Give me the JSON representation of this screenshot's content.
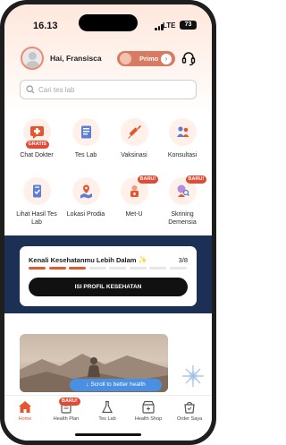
{
  "status_bar": {
    "time": "16.13",
    "network": "LTE",
    "battery": "73"
  },
  "header": {
    "greeting": "Hai, Fransisca",
    "membership_label": "Primo",
    "membership_arrow": "›",
    "support_icon": "headset-icon"
  },
  "search": {
    "placeholder": "Cari tes lab",
    "value": ""
  },
  "menu": [
    {
      "label": "Chat Dokter",
      "icon": "chat-doctor-icon",
      "badge": "GRATIS"
    },
    {
      "label": "Tes Lab",
      "icon": "lab-test-icon",
      "badge": ""
    },
    {
      "label": "Vaksinasi",
      "icon": "vaccine-icon",
      "badge": ""
    },
    {
      "label": "Konsultasi",
      "icon": "consultation-icon",
      "badge": ""
    },
    {
      "label": "Lihat Hasil Tes Lab",
      "icon": "lab-result-icon",
      "badge": ""
    },
    {
      "label": "Lokasi Prodia",
      "icon": "location-icon",
      "badge": ""
    },
    {
      "label": "Met-U",
      "icon": "met-u-icon",
      "badge": "BARU!"
    },
    {
      "label": "Skrining Demensia",
      "icon": "dementia-screening-icon",
      "badge": "BARU!"
    }
  ],
  "health_profile": {
    "title": "Kenali Kesehatanmu Lebih Dalam",
    "progress_text": "3/8",
    "progress_done": 3,
    "progress_total": 8,
    "button_label": "ISI PROFIL KESEHATAN"
  },
  "promo": {
    "scroll_hint": "Scroll to better health"
  },
  "bottom_nav": [
    {
      "label": "Home",
      "icon": "home-icon",
      "active": true,
      "badge": ""
    },
    {
      "label": "Health Plan",
      "icon": "health-plan-icon",
      "active": false,
      "badge": "BARU!"
    },
    {
      "label": "Tes Lab",
      "icon": "flask-icon",
      "active": false,
      "badge": ""
    },
    {
      "label": "Health Shop",
      "icon": "shop-icon",
      "active": false,
      "badge": ""
    },
    {
      "label": "Order Saya",
      "icon": "order-bag-icon",
      "active": false,
      "badge": ""
    }
  ],
  "colors": {
    "accent": "#e4572e",
    "primo": "#d77b63",
    "band": "#1c3055",
    "progress_active": "#e4572e",
    "toast": "#4a90e2"
  }
}
